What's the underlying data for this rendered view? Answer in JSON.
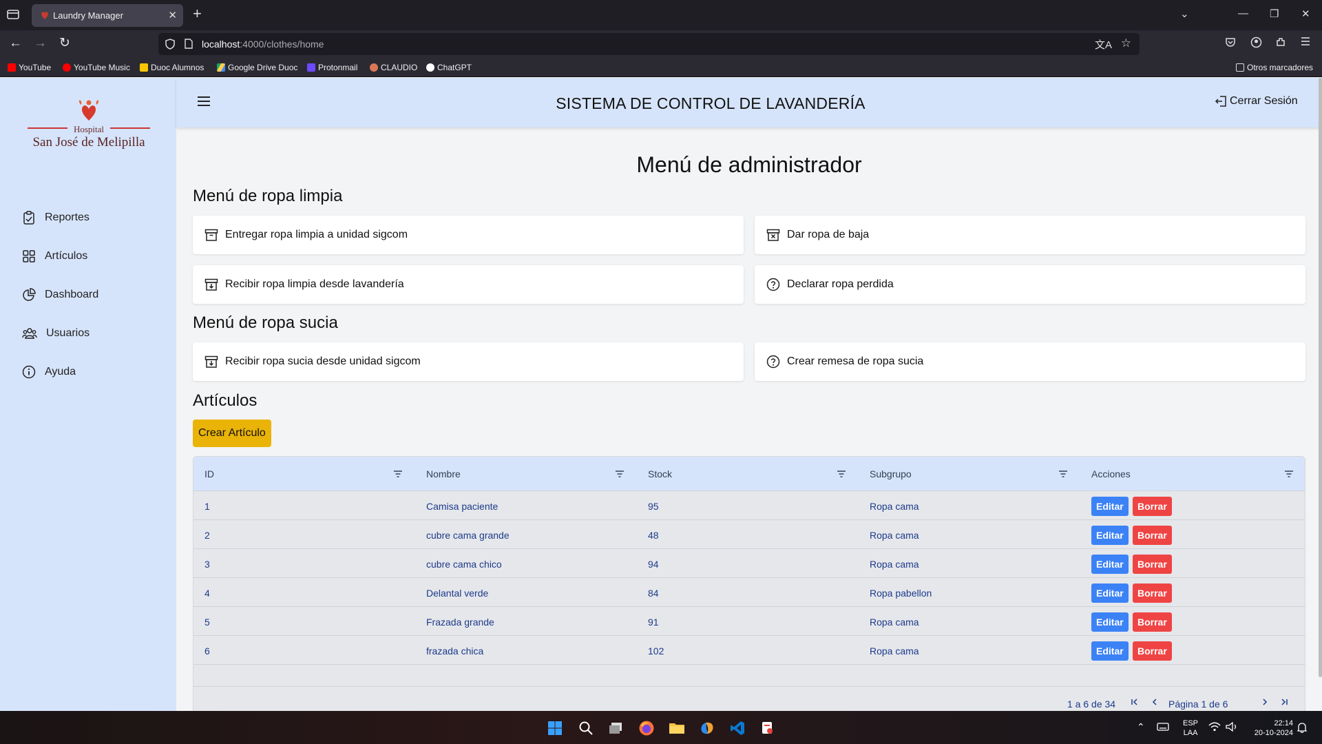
{
  "browser": {
    "tab_title": "Laundry Manager",
    "url_host": "localhost",
    "url_path": ":4000/clothes/home",
    "bookmarks": [
      {
        "label": "YouTube",
        "color": "#ff0000"
      },
      {
        "label": "YouTube Music",
        "color": "#ff0000"
      },
      {
        "label": "Duoc Alumnos",
        "color": "#f7c600"
      },
      {
        "label": "Google Drive Duoc",
        "color": "#1fa463"
      },
      {
        "label": "Protonmail",
        "color": "#6d4aff"
      },
      {
        "label": "CLAUDIO",
        "color": "#d97757"
      },
      {
        "label": "ChatGPT",
        "color": "#ffffff"
      }
    ],
    "other_bookmarks": "Otros marcadores"
  },
  "sidebar": {
    "logo_hospital": "Hospital",
    "logo_name": "San José de Melipilla",
    "items": [
      {
        "label": "Reportes",
        "icon": "clipboard-icon"
      },
      {
        "label": "Artículos",
        "icon": "grid-icon"
      },
      {
        "label": "Dashboard",
        "icon": "pie-chart-icon"
      },
      {
        "label": "Usuarios",
        "icon": "users-icon"
      },
      {
        "label": "Ayuda",
        "icon": "info-icon"
      }
    ]
  },
  "header": {
    "title": "SISTEMA DE CONTROL DE LAVANDERÍA",
    "logout_label": "Cerrar Sesión"
  },
  "main": {
    "page_title": "Menú de administrador",
    "clean_section_title": "Menú de ropa limpia",
    "clean_actions": [
      {
        "label": "Entregar ropa limpia a unidad sigcom",
        "icon": "archive-icon"
      },
      {
        "label": "Dar ropa de baja",
        "icon": "archive-x-icon"
      },
      {
        "label": "Recibir ropa limpia desde lavandería",
        "icon": "archive-down-icon"
      },
      {
        "label": "Declarar ropa perdida",
        "icon": "question-circle-icon"
      }
    ],
    "dirty_section_title": "Menú de ropa sucia",
    "dirty_actions": [
      {
        "label": "Recibir ropa sucia desde unidad sigcom",
        "icon": "archive-down-icon"
      },
      {
        "label": "Crear remesa de ropa sucia",
        "icon": "question-circle-icon"
      }
    ],
    "articles_title": "Artículos",
    "create_button": "Crear Artículo"
  },
  "table": {
    "columns": [
      "ID",
      "Nombre",
      "Stock",
      "Subgrupo",
      "Acciones"
    ],
    "rows": [
      {
        "id": "1",
        "nombre": "Camisa paciente",
        "stock": "95",
        "subgrupo": "Ropa cama"
      },
      {
        "id": "2",
        "nombre": "cubre cama grande",
        "stock": "48",
        "subgrupo": "Ropa cama"
      },
      {
        "id": "3",
        "nombre": "cubre cama chico",
        "stock": "94",
        "subgrupo": "Ropa cama"
      },
      {
        "id": "4",
        "nombre": "Delantal verde",
        "stock": "84",
        "subgrupo": "Ropa pabellon"
      },
      {
        "id": "5",
        "nombre": "Frazada grande",
        "stock": "91",
        "subgrupo": "Ropa cama"
      },
      {
        "id": "6",
        "nombre": "frazada chica",
        "stock": "102",
        "subgrupo": "Ropa cama"
      }
    ],
    "edit_label": "Editar",
    "delete_label": "Borrar",
    "range_label": "1 a 6 de 34",
    "page_label": "Página 1 de 6"
  },
  "taskbar": {
    "lang_line1": "ESP",
    "lang_line2": "LAA",
    "time": "22:14",
    "date": "20-10-2024"
  },
  "colors": {
    "sidebar_bg": "#d6e4fb",
    "create_button": "#eab308",
    "edit_button": "#3b82f6",
    "delete_button": "#ef4444"
  }
}
